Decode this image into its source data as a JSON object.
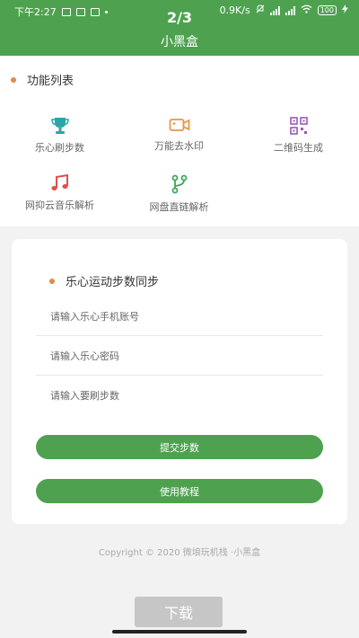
{
  "status_bar": {
    "time": "下午2:27",
    "network_speed": "0.9K/s",
    "battery": "100"
  },
  "header": {
    "page_counter": "2/3",
    "title": "小黑盒"
  },
  "features": {
    "section_title": "功能列表",
    "items": [
      {
        "label": "乐心刷步数",
        "icon": "trophy-icon",
        "color": "#2aa6a6"
      },
      {
        "label": "万能去水印",
        "icon": "video-camera-icon",
        "color": "#e8964b"
      },
      {
        "label": "二维码生成",
        "icon": "qr-code-icon",
        "color": "#9b59b6"
      },
      {
        "label": "网抑云音乐解析",
        "icon": "music-note-icon",
        "color": "#e04e4e"
      },
      {
        "label": "网盘直链解析",
        "icon": "branch-icon",
        "color": "#3aa757"
      }
    ]
  },
  "sync_form": {
    "title": "乐心运动步数同步",
    "phone_placeholder": "请输入乐心手机账号",
    "password_placeholder": "请输入乐心密码",
    "steps_placeholder": "请输入要刷步数",
    "submit_label": "提交步数",
    "tutorial_label": "使用教程"
  },
  "footer": {
    "copyright": "Copyright © 2020 微埌玩机栈 ·小黑盒"
  },
  "download_label": "下载",
  "colors": {
    "primary": "#4ea24f",
    "accent_dot": "#e08a4a",
    "download_bg": "#c6c6c6"
  }
}
